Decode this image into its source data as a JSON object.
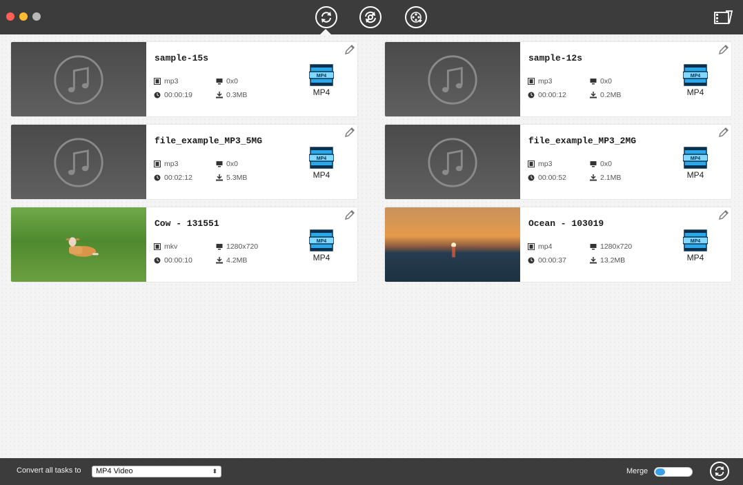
{
  "toolbar": {
    "tools": [
      "convert-icon",
      "rotate-settings-icon",
      "film-reel-download-icon"
    ],
    "corner_icon": "video-editor-icon"
  },
  "cards": [
    {
      "name": "sample-15s",
      "format": "mp3",
      "resolution": "0x0",
      "duration": "00:00:19",
      "size": "0.3MB",
      "target": "MP4",
      "thumb": "music"
    },
    {
      "name": "sample-12s",
      "format": "mp3",
      "resolution": "0x0",
      "duration": "00:00:12",
      "size": "0.2MB",
      "target": "MP4",
      "thumb": "music"
    },
    {
      "name": "file_example_MP3_5MG",
      "format": "mp3",
      "resolution": "0x0",
      "duration": "00:02:12",
      "size": "5.3MB",
      "target": "MP4",
      "thumb": "music"
    },
    {
      "name": "file_example_MP3_2MG",
      "format": "mp3",
      "resolution": "0x0",
      "duration": "00:00:52",
      "size": "2.1MB",
      "target": "MP4",
      "thumb": "music"
    },
    {
      "name": "Cow - 131551",
      "format": "mkv",
      "resolution": "1280x720",
      "duration": "00:00:10",
      "size": "4.2MB",
      "target": "MP4",
      "thumb": "cow"
    },
    {
      "name": "Ocean - 103019",
      "format": "mp4",
      "resolution": "1280x720",
      "duration": "00:00:37",
      "size": "13.2MB",
      "target": "MP4",
      "thumb": "ocean"
    }
  ],
  "bottom": {
    "convert_label": "Convert all tasks to",
    "selected_format": "MP4 Video",
    "merge_label": "Merge",
    "merge_enabled": false
  },
  "colors": {
    "accent": "#3aa0e8",
    "bar": "#3c3c3c"
  }
}
